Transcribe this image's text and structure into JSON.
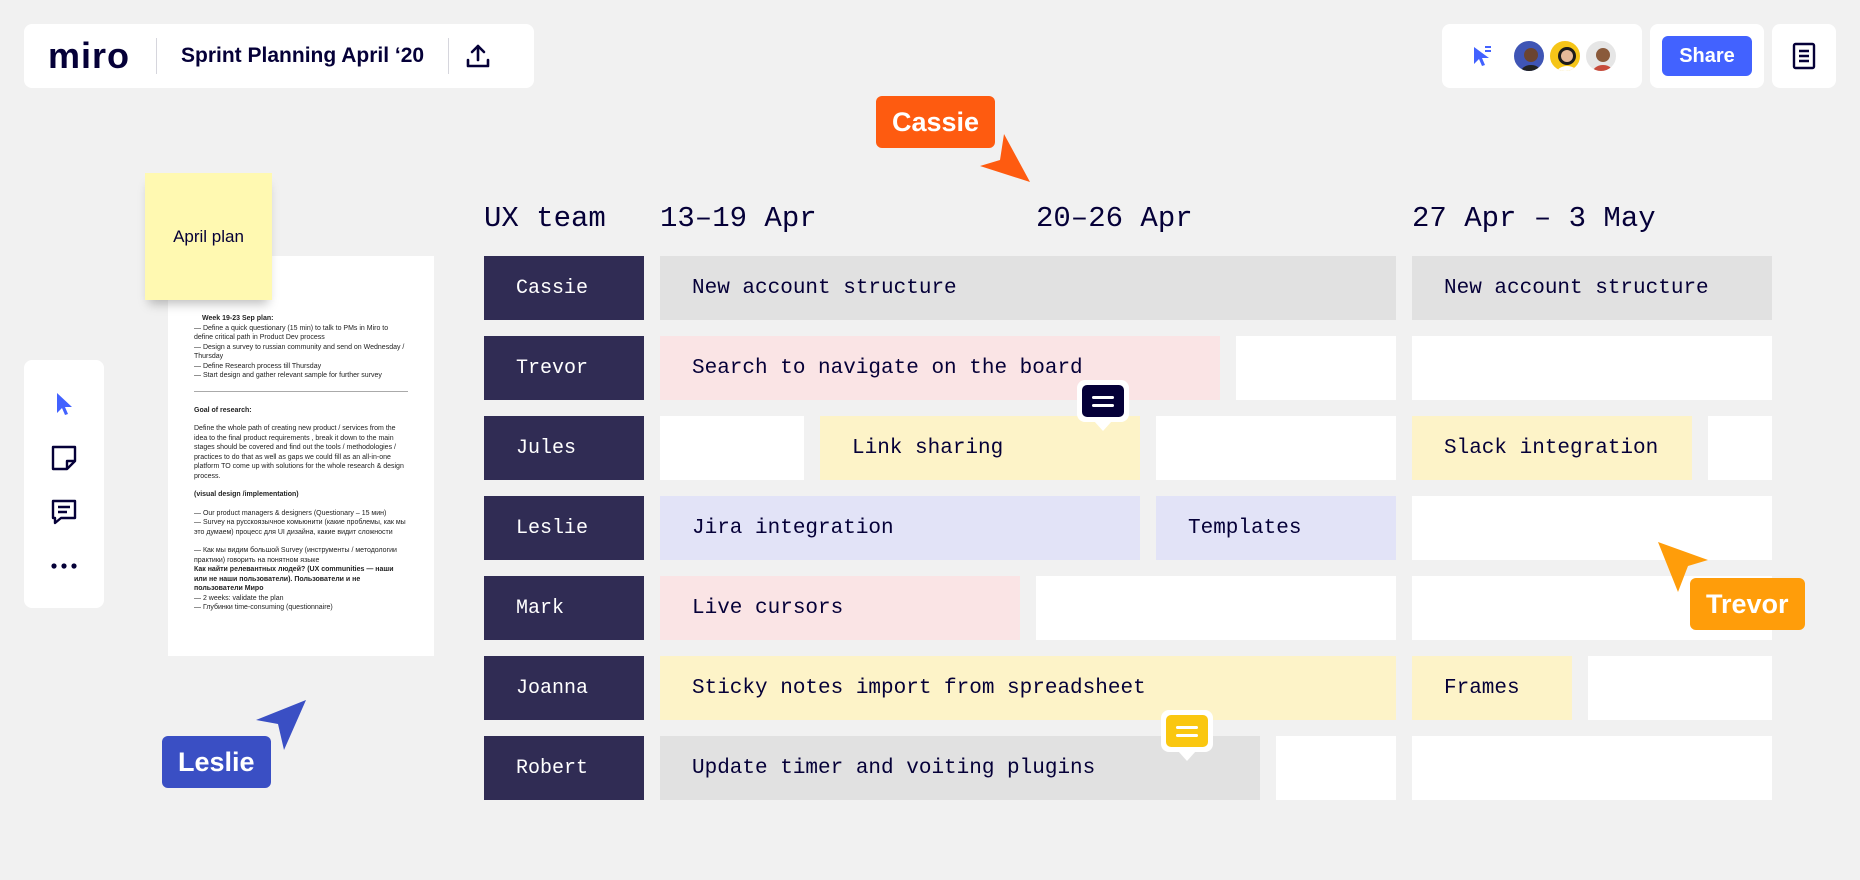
{
  "app": {
    "logo": "miro",
    "board_title": "Sprint Planning April ‘20"
  },
  "header": {
    "share_label": "Share"
  },
  "collaborators": [
    "avatar-1",
    "avatar-2",
    "avatar-3"
  ],
  "toolbar": {
    "tools": [
      "select-icon",
      "sticky-note-icon",
      "comment-icon",
      "more-icon"
    ]
  },
  "sticky": {
    "text": "April plan"
  },
  "document": {
    "lines": [
      {
        "t": "Week 19-23 Sep plan:",
        "b": true,
        "indent": true
      },
      {
        "t": "— Define a quick questionary (15 min) to talk to PMs in Miro to define critical path in Product Dev process"
      },
      {
        "t": "— Design a survey to russian community and send on Wednesday / Thursday"
      },
      {
        "t": "— Define Research process till Thursday"
      },
      {
        "t": "— Start design and gather relevant sample for further survey"
      },
      {
        "hr": true
      },
      {
        "t": "Goal of research:",
        "b": true
      },
      {
        "gap": true
      },
      {
        "t": "Define the whole path of creating new product / services from the idea to the final product requirements , break it down to the main stages should be covered and find out the tools / methodologies / practices to do that as well as gaps we could fill as an all-in-one platform TO come up with solutions for the whole research & design process."
      },
      {
        "gap": true
      },
      {
        "t": "(visual design /implementation)",
        "b": true
      },
      {
        "gap": true
      },
      {
        "t": "— Our product managers & designers (Questionary – 15 мин)"
      },
      {
        "t": "— Survey на русскоязычное комьюнити (какие проблемы, как мы это думаем) процесс для UI дизайна, какие видит сложности"
      },
      {
        "gap": true
      },
      {
        "t": "— Как мы видим большой Survey (инструменты / методологии практики) говорить на понятном языке"
      },
      {
        "t": "Как найти релевантных людей? (UX communities — наши или не наши пользователи). Пользователи и не пользователи Миро",
        "b": true
      },
      {
        "t": "— 2 weeks: validate the plan"
      },
      {
        "t": "— Глубинки time-consuming (questionnaire)"
      }
    ]
  },
  "table": {
    "team_header": "UX team",
    "weeks": [
      "13–19 Apr",
      "20–26 Apr",
      "27 Apr – 3 May"
    ],
    "rows": [
      {
        "name": "Cassie",
        "tasks": [
          "New account structure",
          "New account structure"
        ]
      },
      {
        "name": "Trevor",
        "tasks": [
          "Search to navigate on the board"
        ]
      },
      {
        "name": "Jules",
        "tasks": [
          "Link sharing",
          "Slack integration"
        ]
      },
      {
        "name": "Leslie",
        "tasks": [
          "Jira integration",
          "Templates"
        ]
      },
      {
        "name": "Mark",
        "tasks": [
          "Live cursors"
        ]
      },
      {
        "name": "Joanna",
        "tasks": [
          "Sticky notes import from spreadsheet",
          "Frames"
        ]
      },
      {
        "name": "Robert",
        "tasks": [
          "Update timer and voiting plugins"
        ]
      }
    ]
  },
  "cursors": [
    {
      "name": "Cassie",
      "color": "#fe5b10"
    },
    {
      "name": "Trevor",
      "color": "#ff9d0a"
    },
    {
      "name": "Leslie",
      "color": "#3a4fc4"
    }
  ],
  "comments": [
    {
      "icon": "comment-bubble-icon",
      "color": "#050038"
    },
    {
      "icon": "comment-bubble-icon",
      "color": "#fac710"
    }
  ],
  "colors": {
    "accent": "#4262ff",
    "name_cell": "#302c54"
  }
}
